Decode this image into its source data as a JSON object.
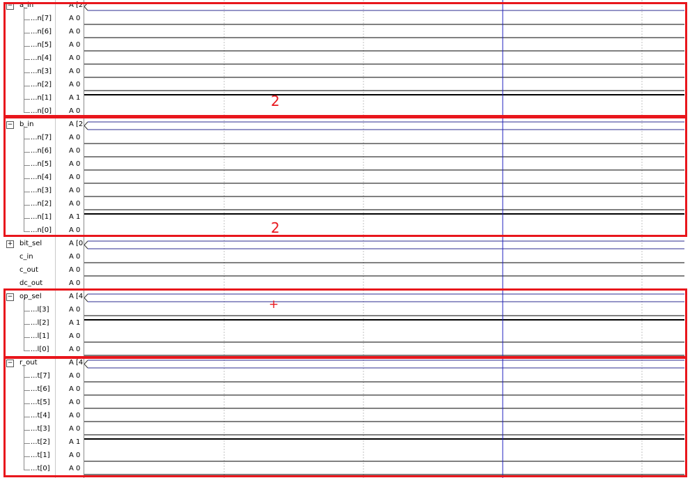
{
  "signals": [
    {
      "name": "a_in",
      "value": "A [2",
      "expander": "−",
      "bus": true,
      "child": false
    },
    {
      "name": "...n[7]",
      "value": "A 0",
      "child": true,
      "wave": "low"
    },
    {
      "name": "...n[6]",
      "value": "A 0",
      "child": true,
      "wave": "low"
    },
    {
      "name": "...n[5]",
      "value": "A 0",
      "child": true,
      "wave": "low"
    },
    {
      "name": "...n[4]",
      "value": "A 0",
      "child": true,
      "wave": "low"
    },
    {
      "name": "...n[3]",
      "value": "A 0",
      "child": true,
      "wave": "low"
    },
    {
      "name": "...n[2]",
      "value": "A 0",
      "child": true,
      "wave": "low"
    },
    {
      "name": "...n[1]",
      "value": "A 1",
      "child": true,
      "wave": "high"
    },
    {
      "name": "...n[0]",
      "value": "A 0",
      "child": true,
      "wave": "low"
    },
    {
      "name": "b_in",
      "value": "A [2",
      "expander": "−",
      "bus": true,
      "child": false
    },
    {
      "name": "...n[7]",
      "value": "A 0",
      "child": true,
      "wave": "low"
    },
    {
      "name": "...n[6]",
      "value": "A 0",
      "child": true,
      "wave": "low"
    },
    {
      "name": "...n[5]",
      "value": "A 0",
      "child": true,
      "wave": "low"
    },
    {
      "name": "...n[4]",
      "value": "A 0",
      "child": true,
      "wave": "low"
    },
    {
      "name": "...n[3]",
      "value": "A 0",
      "child": true,
      "wave": "low"
    },
    {
      "name": "...n[2]",
      "value": "A 0",
      "child": true,
      "wave": "low"
    },
    {
      "name": "...n[1]",
      "value": "A 1",
      "child": true,
      "wave": "high"
    },
    {
      "name": "...n[0]",
      "value": "A 0",
      "child": true,
      "wave": "low"
    },
    {
      "name": "bit_sel",
      "value": "A [0",
      "expander": "+",
      "bus": true,
      "child": false
    },
    {
      "name": "c_in",
      "value": "A 0",
      "child": false,
      "wave": "low"
    },
    {
      "name": "c_out",
      "value": "A 0",
      "child": false,
      "wave": "low"
    },
    {
      "name": "dc_out",
      "value": "A 0",
      "child": false,
      "wave": "low"
    },
    {
      "name": "op_sel",
      "value": "A [4",
      "expander": "−",
      "bus": true,
      "child": false
    },
    {
      "name": "...l[3]",
      "value": "A 0",
      "child": true,
      "wave": "low"
    },
    {
      "name": "...l[2]",
      "value": "A 1",
      "child": true,
      "wave": "high"
    },
    {
      "name": "...l[1]",
      "value": "A 0",
      "child": true,
      "wave": "low"
    },
    {
      "name": "...l[0]",
      "value": "A 0",
      "child": true,
      "wave": "low"
    },
    {
      "name": "r_out",
      "value": "A [4",
      "expander": "−",
      "bus": true,
      "child": false
    },
    {
      "name": "...t[7]",
      "value": "A 0",
      "child": true,
      "wave": "low"
    },
    {
      "name": "...t[6]",
      "value": "A 0",
      "child": true,
      "wave": "low"
    },
    {
      "name": "...t[5]",
      "value": "A 0",
      "child": true,
      "wave": "low"
    },
    {
      "name": "...t[4]",
      "value": "A 0",
      "child": true,
      "wave": "low"
    },
    {
      "name": "...t[3]",
      "value": "A 0",
      "child": true,
      "wave": "low"
    },
    {
      "name": "...t[2]",
      "value": "A 1",
      "child": true,
      "wave": "high"
    },
    {
      "name": "...t[1]",
      "value": "A 0",
      "child": true,
      "wave": "low"
    },
    {
      "name": "...t[0]",
      "value": "A 0",
      "child": true,
      "wave": "low"
    }
  ],
  "annotations": {
    "a_in_value": "2",
    "b_in_value": "2",
    "op_sel_symbol": "+"
  },
  "colors": {
    "highlight": "#e8161c",
    "cursor": "#1f1fbf",
    "bus_line": "#2b2b8f",
    "grid": "#c0c0c0",
    "wave": "#000000"
  }
}
